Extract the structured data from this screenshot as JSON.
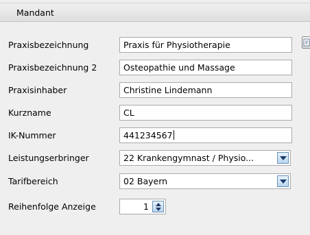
{
  "section": {
    "title": "Mandant"
  },
  "fields": [
    {
      "label": "Praxisbezeichnung",
      "value": "Praxis für Physiotherapie"
    },
    {
      "label": "Praxisbezeichnung 2",
      "value": "Osteopathie und Massage"
    },
    {
      "label": "Praxisinhaber",
      "value": "Christine Lindemann"
    },
    {
      "label": "Kurzname",
      "value": "CL"
    },
    {
      "label": "IK-Nummer",
      "value": "441234567"
    },
    {
      "label": "Leistungserbringer",
      "value": "22 Krankengymnast / Physio..."
    },
    {
      "label": "Tarifbereich",
      "value": "02 Bayern"
    },
    {
      "label": "Reihenfolge Anzeige",
      "value": "1"
    }
  ],
  "icons": {
    "side_button": "lookup-icon",
    "dropdown": "chevron-down-icon",
    "spinner": "spinner-arrows-icon"
  },
  "colors": {
    "accent": "#1c3b6b",
    "button_face": "#b9d5ef"
  }
}
